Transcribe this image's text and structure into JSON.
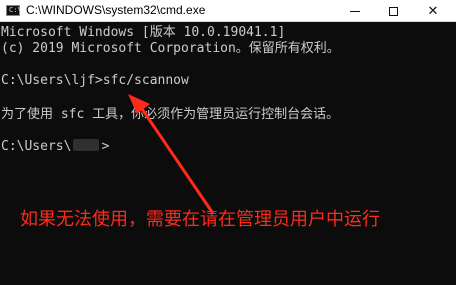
{
  "window": {
    "title": "C:\\WINDOWS\\system32\\cmd.exe",
    "icon": "cmd-icon"
  },
  "controls": {
    "minimize_icon": "minimize-icon",
    "maximize_icon": "maximize-icon",
    "close_icon": "close-icon",
    "close_glyph": "✕"
  },
  "console": {
    "lines": [
      "Microsoft Windows [版本 10.0.19041.1]",
      "(c) 2019 Microsoft Corporation。保留所有权利。",
      "",
      "C:\\Users\\ljf>sfc/scannow",
      "",
      "为了使用 sfc 工具，你必须作为管理员运行控制台会话。",
      "",
      "C:\\Users\\",
      ">"
    ]
  },
  "annotation": {
    "text": "如果无法使用，需要在请在管理员用户中运行",
    "color": "#ff2a1a"
  },
  "colors": {
    "console_bg": "#0c0c0c",
    "console_text": "#cccccc",
    "titlebar_bg": "#ffffff"
  }
}
